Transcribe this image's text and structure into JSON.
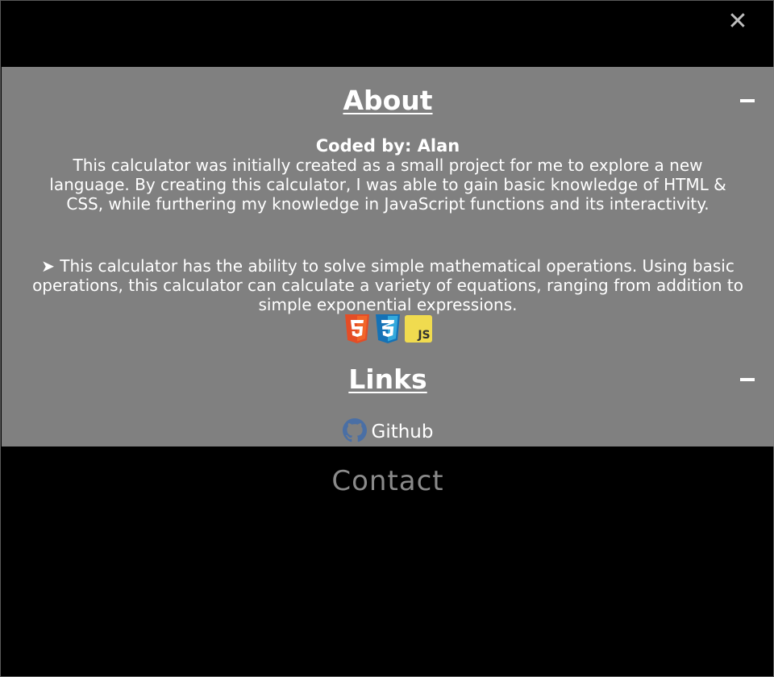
{
  "close_button": {
    "label": "✕",
    "icon": "close-icon"
  },
  "about": {
    "title": "About",
    "collapse_label": "−",
    "coded_by": "Coded by: Alan",
    "paragraph_1": "This calculator was initially created as a small project for me to explore a new language. By creating this calculator, I was able to gain basic knowledge of HTML & CSS, while furthering my knowledge in JavaScript functions and its interactivity.",
    "paragraph_2": "➤ This calculator has the ability to solve simple mathematical operations. Using basic operations, this calculator can calculate a variety of equations, ranging from addition to simple exponential expressions.",
    "tech_icons": [
      {
        "name": "html5-icon",
        "label": "5",
        "color": "#e44d26"
      },
      {
        "name": "css3-icon",
        "label": "3",
        "color": "#1572b6"
      },
      {
        "name": "javascript-icon",
        "label": "JS",
        "color": "#f0db4f"
      }
    ]
  },
  "links": {
    "title": "Links",
    "collapse_label": "−",
    "github_label": "Github",
    "github_icon": "github-icon",
    "github_icon_color": "#4a6fa5"
  },
  "contact": {
    "label": "Contact",
    "color": "#8a8a8a"
  },
  "colors": {
    "page_background": "#000000",
    "panel_background": "#808080",
    "text": "#ffffff",
    "close_icon": "#bdbdbd"
  }
}
